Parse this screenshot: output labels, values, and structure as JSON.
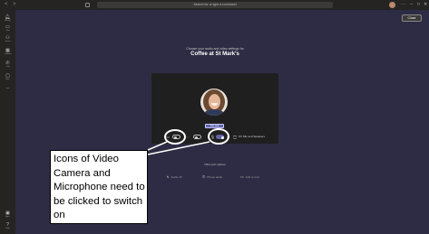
{
  "titlebar": {
    "search_placeholder": "Search for or type a command"
  },
  "rail": {
    "items": [
      {
        "label": "Activity",
        "icon": "bell-icon"
      },
      {
        "label": "Chat",
        "icon": "chat-icon"
      },
      {
        "label": "Teams",
        "icon": "teams-icon"
      },
      {
        "label": "Calendar",
        "icon": "calendar-icon"
      },
      {
        "label": "Calls",
        "icon": "phone-icon"
      },
      {
        "label": "Files",
        "icon": "files-icon"
      },
      {
        "label": "...",
        "icon": "more-icon"
      }
    ],
    "bottom": [
      {
        "label": "Apps",
        "icon": "apps-icon"
      },
      {
        "label": "Help",
        "icon": "help-icon"
      }
    ]
  },
  "header": {
    "close_label": "Close"
  },
  "join": {
    "prompt": "Choose your audio and video settings for",
    "meeting_title": "Coffee at St Mark's",
    "edit_label": "Join now",
    "device_label": "PC Mic and Speakers",
    "other_title": "Other join options",
    "options": [
      {
        "label": "Audio off",
        "icon": "speaker-off-icon"
      },
      {
        "label": "Phone audio",
        "icon": "phone-icon"
      },
      {
        "label": "Add a room",
        "icon": "room-icon"
      }
    ]
  },
  "controls": {
    "camera_on": false,
    "mic_on": true,
    "blur_on": false
  },
  "annotation": {
    "text": "Icons of Video Camera and Microphone need to be clicked to switch on"
  },
  "colors": {
    "stage": "#2d2c44",
    "accent": "#6264a7",
    "rail": "#252423"
  }
}
